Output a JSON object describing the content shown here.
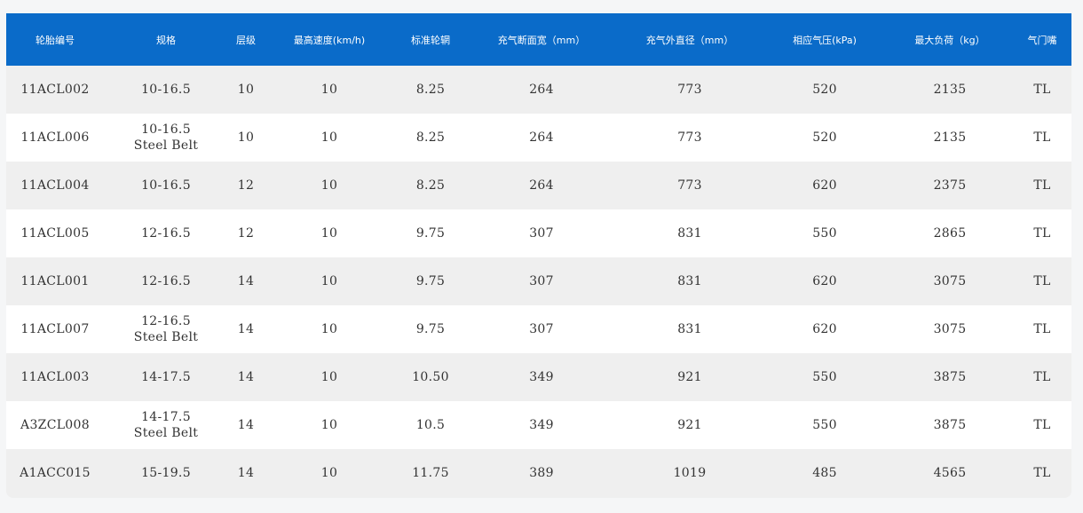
{
  "table": {
    "headers": [
      "轮胎编号",
      "规格",
      "层级",
      "最高速度(km/h)",
      "标准轮辋",
      "充气断面宽（mm）",
      "充气外直径（mm）",
      "相应气压(kPa)",
      "最大负荷（kg）",
      "气门嘴"
    ],
    "rows": [
      {
        "id": "11ACL002",
        "spec": [
          "10-16.5"
        ],
        "ply": "10",
        "speed": "10",
        "rim": "8.25",
        "width": "264",
        "diameter": "773",
        "pressure": "520",
        "load": "2135",
        "valve": "TL"
      },
      {
        "id": "11ACL006",
        "spec": [
          "10-16.5",
          "Steel Belt"
        ],
        "ply": "10",
        "speed": "10",
        "rim": "8.25",
        "width": "264",
        "diameter": "773",
        "pressure": "520",
        "load": "2135",
        "valve": "TL"
      },
      {
        "id": "11ACL004",
        "spec": [
          "10-16.5"
        ],
        "ply": "12",
        "speed": "10",
        "rim": "8.25",
        "width": "264",
        "diameter": "773",
        "pressure": "620",
        "load": "2375",
        "valve": "TL"
      },
      {
        "id": "11ACL005",
        "spec": [
          "12-16.5"
        ],
        "ply": "12",
        "speed": "10",
        "rim": "9.75",
        "width": "307",
        "diameter": "831",
        "pressure": "550",
        "load": "2865",
        "valve": "TL"
      },
      {
        "id": "11ACL001",
        "spec": [
          "12-16.5"
        ],
        "ply": "14",
        "speed": "10",
        "rim": "9.75",
        "width": "307",
        "diameter": "831",
        "pressure": "620",
        "load": "3075",
        "valve": "TL"
      },
      {
        "id": "11ACL007",
        "spec": [
          "12-16.5",
          "Steel Belt"
        ],
        "ply": "14",
        "speed": "10",
        "rim": "9.75",
        "width": "307",
        "diameter": "831",
        "pressure": "620",
        "load": "3075",
        "valve": "TL"
      },
      {
        "id": "11ACL003",
        "spec": [
          "14-17.5"
        ],
        "ply": "14",
        "speed": "10",
        "rim": "10.50",
        "width": "349",
        "diameter": "921",
        "pressure": "550",
        "load": "3875",
        "valve": "TL"
      },
      {
        "id": "A3ZCL008",
        "spec": [
          "14-17.5",
          "Steel Belt"
        ],
        "ply": "14",
        "speed": "10",
        "rim": "10.5",
        "width": "349",
        "diameter": "921",
        "pressure": "550",
        "load": "3875",
        "valve": "TL"
      },
      {
        "id": "A1ACC015",
        "spec": [
          "15-19.5"
        ],
        "ply": "14",
        "speed": "10",
        "rim": "11.75",
        "width": "389",
        "diameter": "1019",
        "pressure": "485",
        "load": "4565",
        "valve": "TL"
      }
    ]
  },
  "colors": {
    "header_bg": "#0a6bc9",
    "header_text": "#ffffff",
    "row_odd": "#efefef",
    "row_even": "#ffffff",
    "cell_text": "#333333"
  }
}
